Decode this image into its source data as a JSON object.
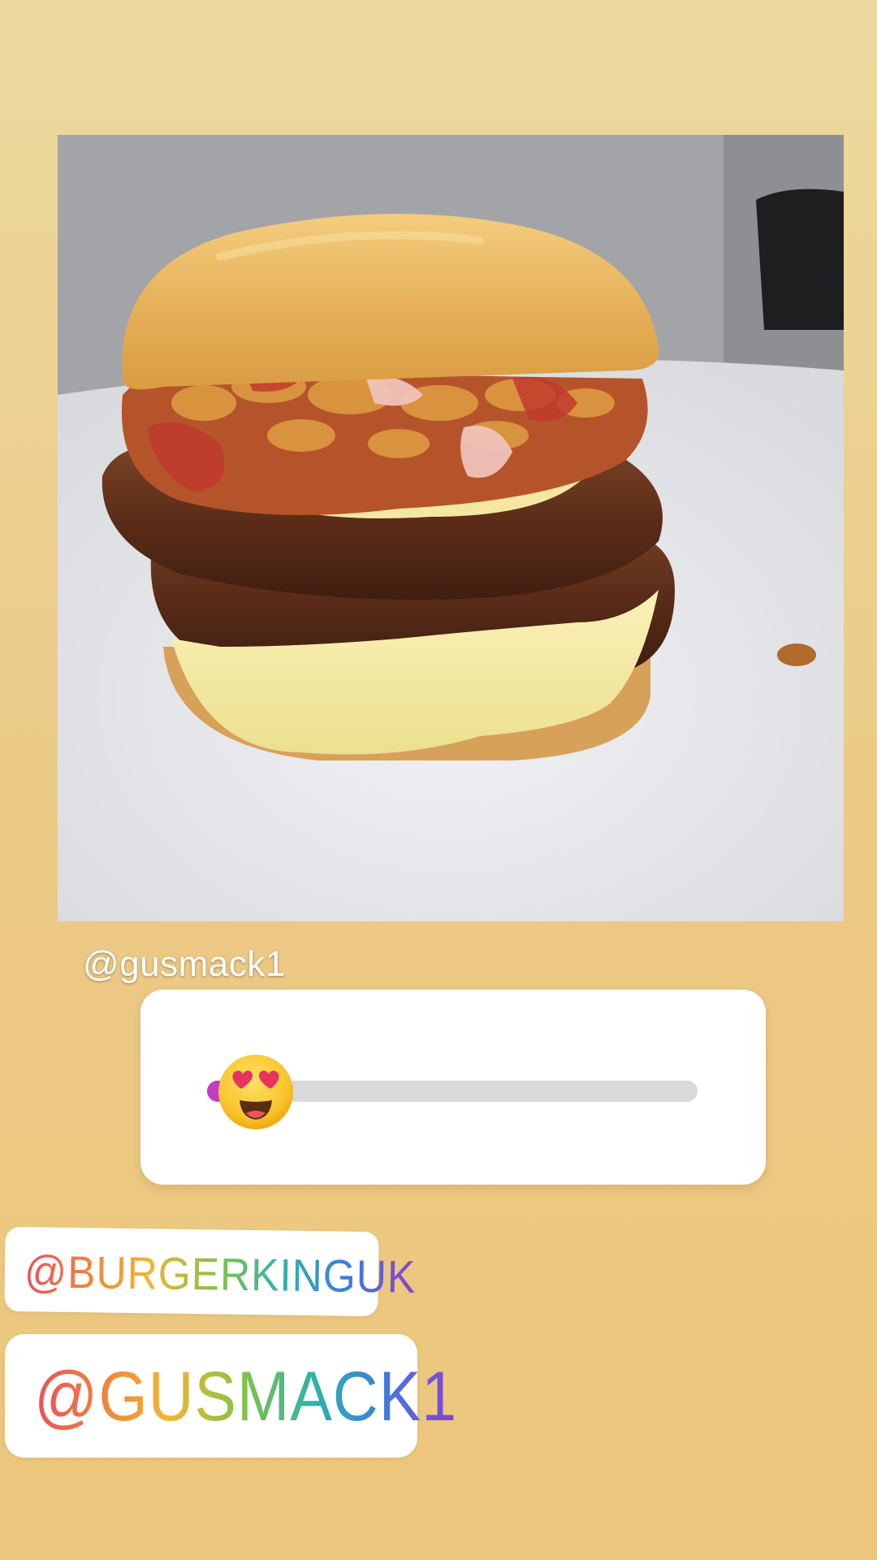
{
  "story": {
    "caption_mention": "@gusmack1",
    "emoji_slider": {
      "emoji": "smiling-face-with-heart-eyes",
      "value": 0.07
    },
    "mention_stickers": [
      {
        "text": "@BURGERKINGUK"
      },
      {
        "text": "@GUSMACK1"
      }
    ],
    "colors": {
      "background_top": "#ecd99f",
      "background_bottom": "#ecc67c",
      "slider_fill": "#c63ac9",
      "slider_track": "#d9d9d9"
    }
  }
}
